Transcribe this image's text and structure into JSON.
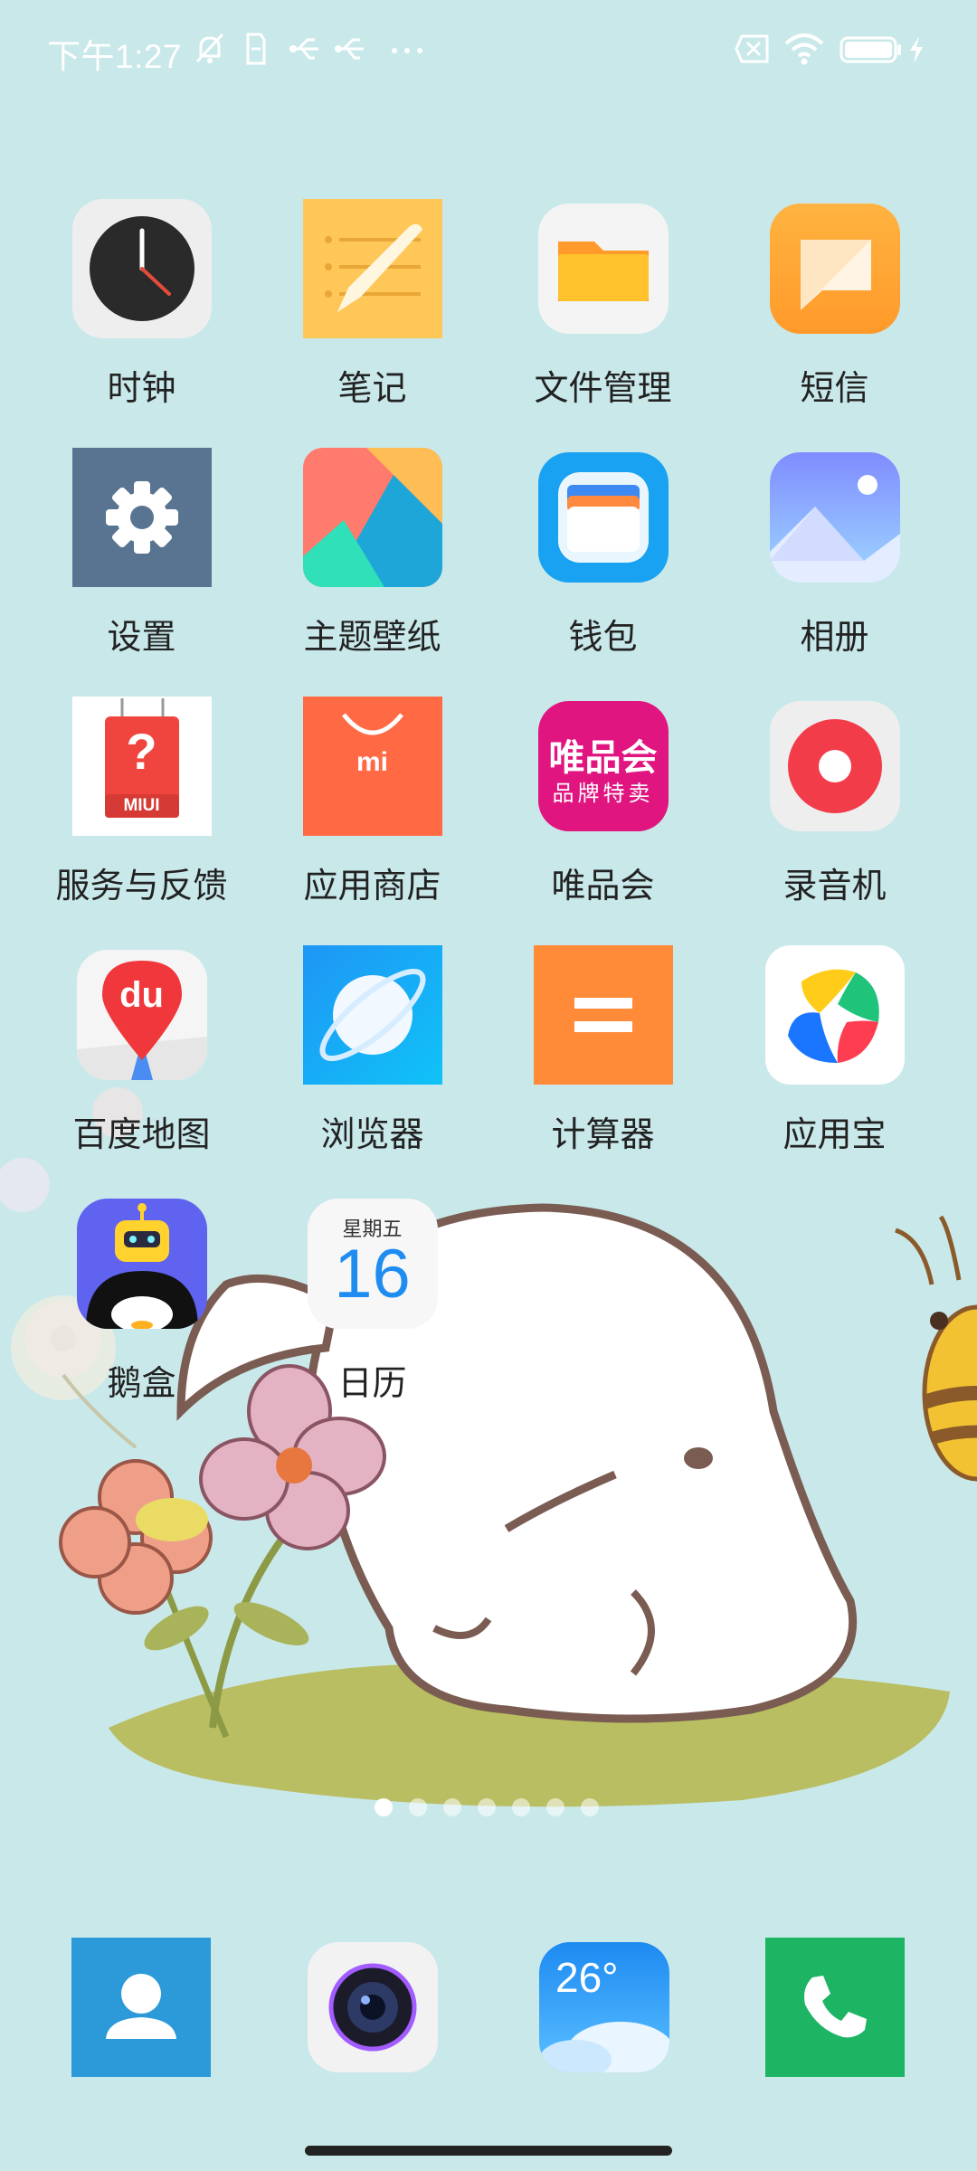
{
  "status_bar": {
    "time": "下午1:27",
    "icons": [
      "mute-icon",
      "sim-icon",
      "usb-icon",
      "usb-icon",
      "more-icon",
      "no-sim-icon",
      "wifi-icon",
      "battery-icon",
      "charging-icon"
    ]
  },
  "apps": [
    {
      "label": "时钟",
      "icon": "clock-icon"
    },
    {
      "label": "笔记",
      "icon": "notes-icon"
    },
    {
      "label": "文件管理",
      "icon": "folder-icon"
    },
    {
      "label": "短信",
      "icon": "message-icon"
    },
    {
      "label": "设置",
      "icon": "gear-icon"
    },
    {
      "label": "主题壁纸",
      "icon": "themes-icon"
    },
    {
      "label": "钱包",
      "icon": "wallet-icon"
    },
    {
      "label": "相册",
      "icon": "gallery-icon"
    },
    {
      "label": "服务与反馈",
      "icon": "feedback-icon"
    },
    {
      "label": "应用商店",
      "icon": "app-store-icon"
    },
    {
      "label": "唯品会",
      "icon": "vip-icon"
    },
    {
      "label": "录音机",
      "icon": "recorder-icon"
    },
    {
      "label": "百度地图",
      "icon": "baidu-map-icon"
    },
    {
      "label": "浏览器",
      "icon": "browser-icon"
    },
    {
      "label": "计算器",
      "icon": "calculator-icon"
    },
    {
      "label": "应用宝",
      "icon": "yingyongbao-icon"
    },
    {
      "label": "鹅盒",
      "icon": "ehe-icon"
    },
    {
      "label": "日历",
      "icon": "calendar-icon"
    }
  ],
  "icon_text": {
    "feedback_brand": "MIUI",
    "feedback_mark": "?",
    "store_brand": "mi",
    "vip_line1": "唯品会",
    "vip_line2": "品牌特卖",
    "baidu_brand": "du",
    "calendar_weekday": "星期五",
    "calendar_day": "16",
    "weather_temp": "26°"
  },
  "page_indicator": {
    "count": 7,
    "active_index": 0
  },
  "dock": [
    {
      "icon": "contacts-icon"
    },
    {
      "icon": "camera-icon"
    },
    {
      "icon": "weather-icon"
    },
    {
      "icon": "phone-icon"
    }
  ]
}
